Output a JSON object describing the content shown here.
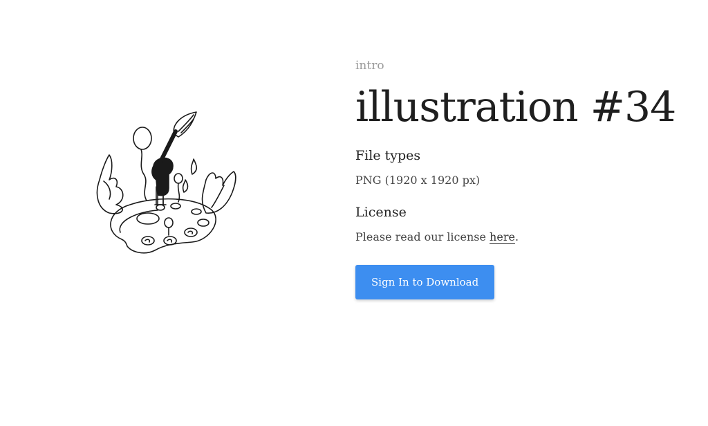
{
  "header": {
    "category": "intro",
    "title": "illustration #34"
  },
  "file_types": {
    "heading": "File types",
    "value": "PNG (1920 x 1920 px)"
  },
  "license": {
    "heading": "License",
    "text_before": "Please read our license ",
    "link_label": "here",
    "text_after": "."
  },
  "actions": {
    "download_label": "Sign In to Download"
  },
  "illustration": {
    "subject": "artist-palette-sketch"
  },
  "colors": {
    "button_bg": "#3d8ef0",
    "muted_text": "#9a9a9a"
  }
}
